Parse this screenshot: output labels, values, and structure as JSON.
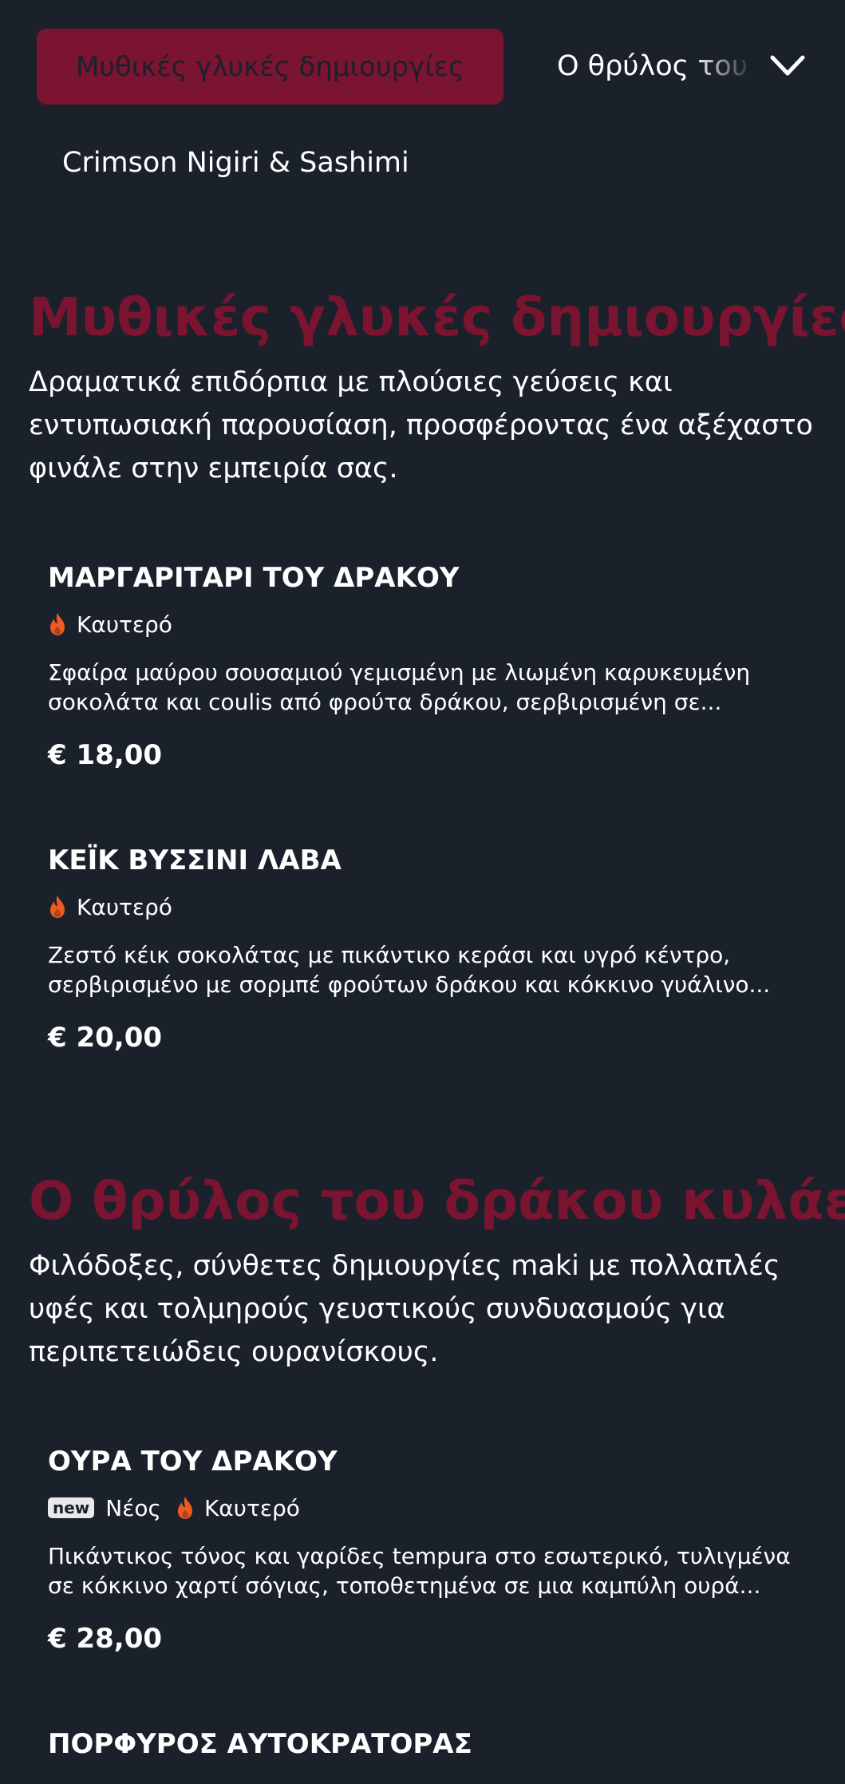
{
  "nav": {
    "active_tab": "Μυθικές γλυκές δημιουργίες",
    "tab2": "Ο θρύλος του δράκου κυλάει",
    "tab3": "Crimson Nigiri & Sashimi"
  },
  "colors": {
    "background": "#1b212b",
    "accent": "#7a1430",
    "flame": "#f05a22"
  },
  "sections": [
    {
      "title": "Μυθικές γλυκές δημιουργίες",
      "description": "Δραματικά επιδόρπια με πλούσιες γεύσεις και εντυπωσιακή παρουσίαση, προσφέροντας ένα αξέχαστο φινάλε στην εμπειρία σας.",
      "items": [
        {
          "name": "ΜΑΡΓΑΡΙΤΑΡΙ ΤΟΥ ΔΡΑΚΟΥ",
          "tag_spicy": "Καυτερό",
          "description": "Σφαίρα μαύρου σουσαμιού γεμισμένη με λιωμένη καρυκευμένη σοκολάτα και coulis από φρούτα δράκου, σερβιρισμένη σε...",
          "price": "€ 18,00"
        },
        {
          "name": "ΚΕΪΚ ΒΥΣΣΙΝΙ ΛΑΒΑ",
          "tag_spicy": "Καυτερό",
          "description": "Ζεστό κέικ σοκολάτας με πικάντικο κεράσι και υγρό κέντρο, σερβιρισμένο με σορμπέ φρούτων δράκου και κόκκινο γυάλινο...",
          "price": "€ 20,00"
        }
      ]
    },
    {
      "title": "Ο θρύλος του δράκου κυλάει",
      "description": "Φιλόδοξες, σύνθετες δημιουργίες maki με πολλαπλές υφές και τολμηρούς γευστικούς συνδυασμούς για περιπετειώδεις ουρανίσκους.",
      "items": [
        {
          "name": "ΟΥΡΑ ΤΟΥ ΔΡΑΚΟΥ",
          "badge_new": "new",
          "tag_new": "Νέος",
          "tag_spicy": "Καυτερό",
          "description": "Πικάντικος τόνος και γαρίδες tempura στο εσωτερικό, τυλιγμένα σε κόκκινο χαρτί σόγιας, τοποθετημένα σε μια καμπύλη ουρά...",
          "price": "€ 28,00"
        },
        {
          "name": "ΠΟΡΦΥΡΟΣ ΑΥΤΟΚΡΑΤΟΡΑΣ"
        }
      ]
    }
  ]
}
